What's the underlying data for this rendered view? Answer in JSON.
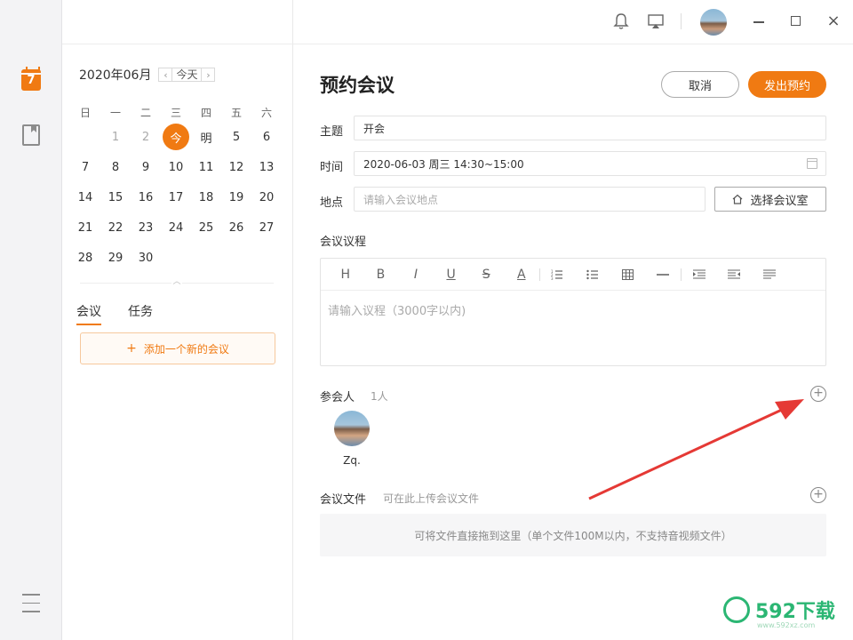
{
  "rail": {
    "calendar_day": "7"
  },
  "calendar": {
    "month_label": "2020年06月",
    "prev": "‹",
    "today_btn": "今天",
    "next": "›",
    "weekdays": [
      "日",
      "一",
      "二",
      "三",
      "四",
      "五",
      "六"
    ],
    "days": [
      "",
      "1",
      "2",
      "今",
      "明",
      "5",
      "6",
      "7",
      "8",
      "9",
      "10",
      "11",
      "12",
      "13",
      "14",
      "15",
      "16",
      "17",
      "18",
      "19",
      "20",
      "21",
      "22",
      "23",
      "24",
      "25",
      "26",
      "27",
      "28",
      "29",
      "30",
      "",
      "",
      "",
      ""
    ]
  },
  "panel_tabs": [
    "会议",
    "任务"
  ],
  "add_meeting": {
    "plus": "+",
    "label": "添加一个新的会议"
  },
  "form": {
    "title": "预约会议",
    "cancel": "取消",
    "submit": "发出预约",
    "subject_label": "主题",
    "subject_value": "开会",
    "time_label": "时间",
    "time_value": "2020-06-03 周三 14:30~15:00",
    "location_label": "地点",
    "location_placeholder": "请输入会议地点",
    "room_button": "选择会议室",
    "agenda_label": "会议议程",
    "agenda_placeholder": "请输入议程（3000字以内)",
    "toolbar": [
      "H",
      "B",
      "I",
      "U",
      "S",
      "A",
      "",
      "",
      "",
      "",
      "",
      "",
      "",
      ""
    ],
    "participants_label": "参会人",
    "participants_count": "1人",
    "participant_name": "Zq.",
    "files_label": "会议文件",
    "files_hint": "可在此上传会议文件",
    "dropzone_text": "可将文件直接拖到这里（单个文件100M以内，不支持音视频文件）"
  },
  "watermark": {
    "text": "592下载",
    "sub": "www.592xz.com"
  },
  "colors": {
    "accent": "#f07a12",
    "arrow": "#e53935",
    "watermark": "#2bb673"
  }
}
